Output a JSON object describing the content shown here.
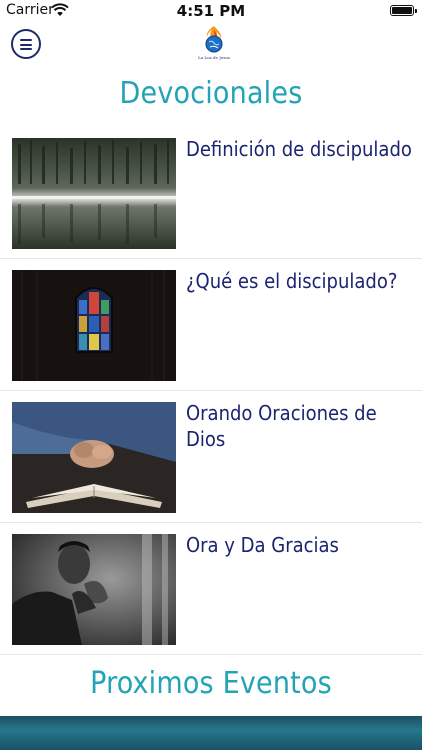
{
  "status_bar": {
    "carrier": "Carrier",
    "time": "4:51 PM"
  },
  "header": {
    "logo_text": "La Luz de Jesus"
  },
  "devotionals": {
    "title": "Devocionales",
    "items": [
      {
        "title": "Definición de discipulado",
        "thumb_icon": "misty-forest-lake-image"
      },
      {
        "title": "¿Qué es el discipulado?",
        "thumb_icon": "stained-glass-window-image"
      },
      {
        "title": "Orando Oraciones de Dios",
        "thumb_icon": "hands-praying-on-bible-image"
      },
      {
        "title": "Ora y Da Gracias",
        "thumb_icon": "man-praying-image"
      }
    ]
  },
  "events": {
    "title": "Proximos Eventos"
  },
  "colors": {
    "accent": "#22a4b6",
    "title_text": "#1b2470",
    "menu": "#1f2a6b"
  }
}
